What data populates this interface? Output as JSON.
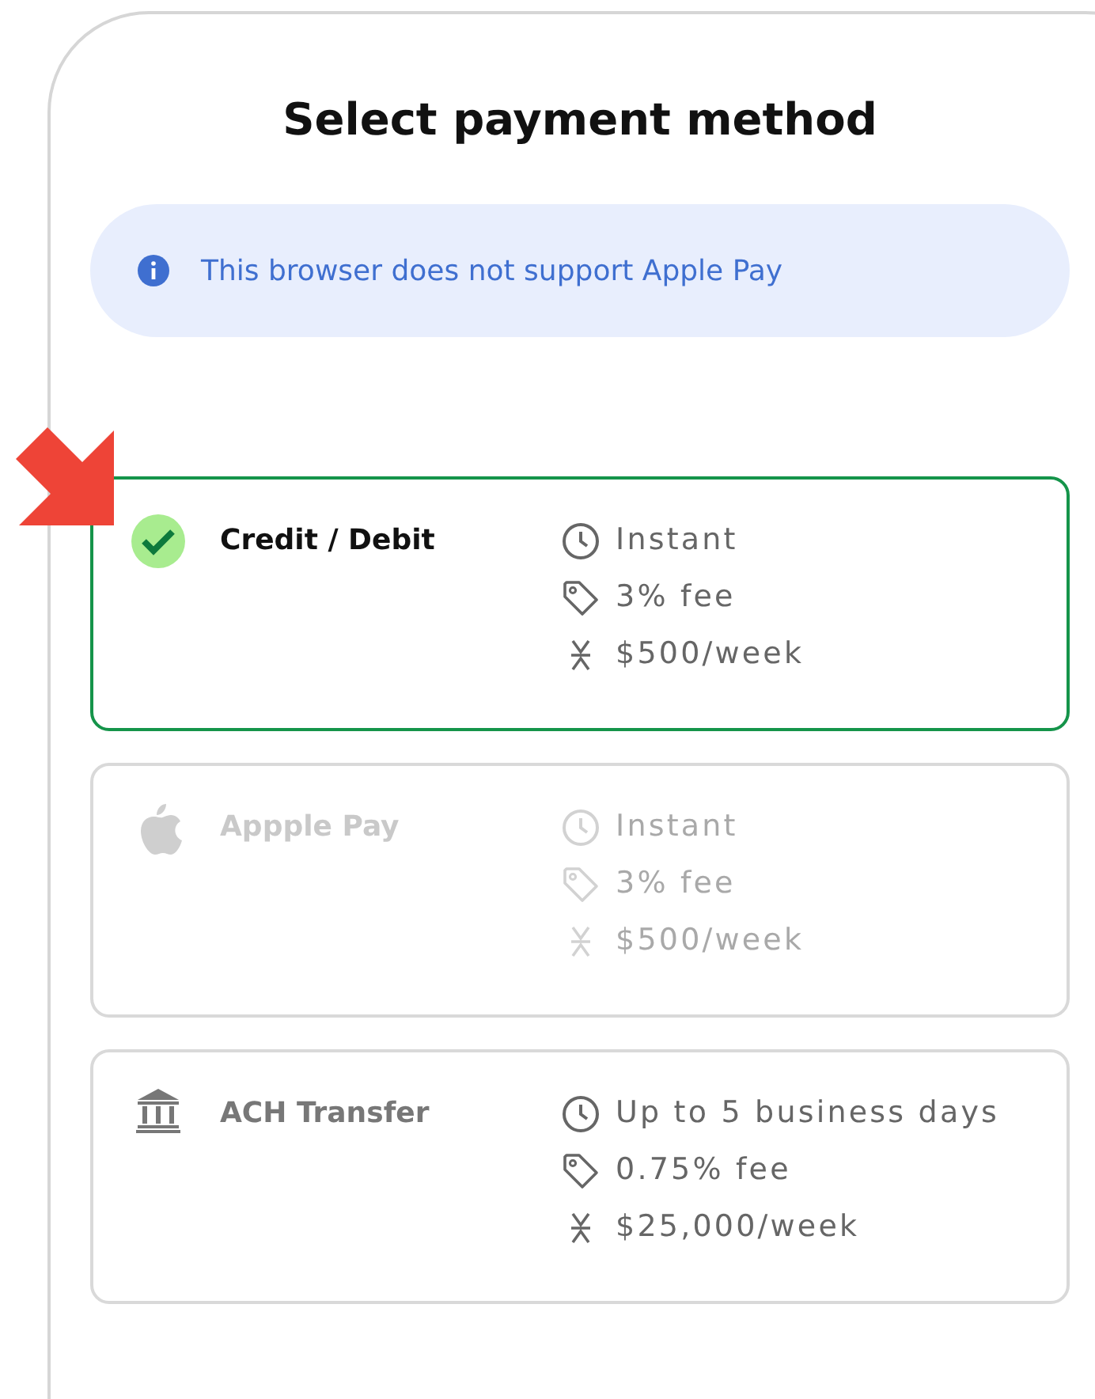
{
  "title": "Select payment method",
  "notice": {
    "text": "This browser does not support Apple Pay"
  },
  "methods": [
    {
      "kind": "card",
      "name": "Credit / Debit",
      "selected": true,
      "disabled": false,
      "details": [
        {
          "kind": "time",
          "text": "Instant"
        },
        {
          "kind": "fee",
          "text": "3% fee"
        },
        {
          "kind": "limit",
          "text": "$500/week"
        }
      ]
    },
    {
      "kind": "wallet",
      "name": "Appple Pay",
      "selected": false,
      "disabled": true,
      "details": [
        {
          "kind": "time",
          "text": "Instant"
        },
        {
          "kind": "fee",
          "text": "3% fee"
        },
        {
          "kind": "limit",
          "text": "$500/week"
        }
      ]
    },
    {
      "kind": "bank",
      "name": "ACH Transfer",
      "selected": false,
      "disabled": false,
      "details": [
        {
          "kind": "time",
          "text": "Up to 5 business days"
        },
        {
          "kind": "fee",
          "text": "0.75% fee"
        },
        {
          "kind": "limit",
          "text": "$25,000/week"
        }
      ]
    }
  ]
}
